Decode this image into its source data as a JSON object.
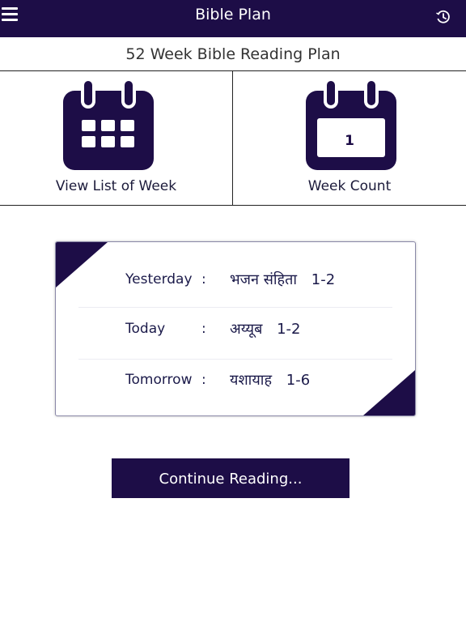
{
  "header": {
    "title": "Bible Plan",
    "menu_icon": "hamburger-icon",
    "history_icon": "history-clock-icon"
  },
  "subtitle": "52 Week Bible Reading Plan",
  "tiles": {
    "week_list": {
      "label": "View List of Week",
      "icon": "calendar-grid-icon"
    },
    "week_count": {
      "label": "Week Count",
      "value": "1",
      "icon": "calendar-number-icon"
    }
  },
  "reading": {
    "yesterday": {
      "label": "Yesterday",
      "colon": ":",
      "book": "भजन संहिता",
      "chapters": "1-2"
    },
    "today": {
      "label": "Today",
      "colon": ":",
      "book": "अय्यूब",
      "chapters": "1-2"
    },
    "tomorrow": {
      "label": "Tomorrow",
      "colon": ":",
      "book": "यशायाह",
      "chapters": "1-6"
    }
  },
  "continue_label": "Continue Reading...",
  "colors": {
    "primary": "#1d0d47",
    "background": "#ffffff",
    "text": "#1b1a4a"
  }
}
